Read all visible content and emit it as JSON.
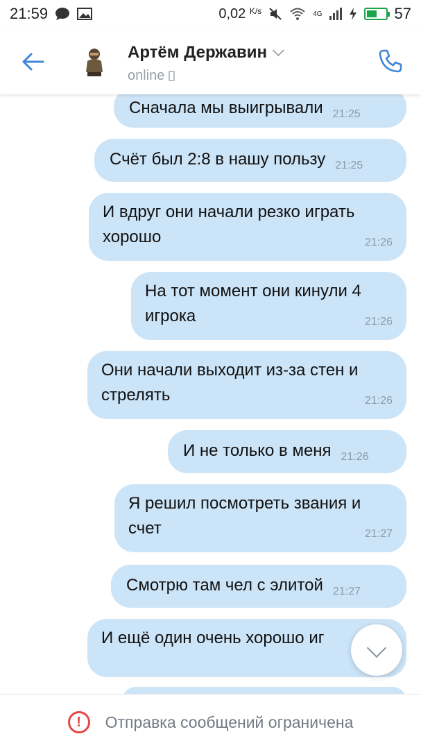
{
  "status_bar": {
    "time": "21:59",
    "speed": "0,02",
    "speed_unit": "K/s",
    "network": "4G",
    "battery": "57",
    "battery_level": 0.57
  },
  "header": {
    "contact_name": "Артём Державин",
    "presence": "online"
  },
  "messages": [
    {
      "text": "Сначала мы выигрывали",
      "time": "21:25"
    },
    {
      "text": "Счёт был 2:8 в нашу пользу",
      "time": "21:25"
    },
    {
      "text": "И вдруг они начали резко играть хорошо",
      "time": "21:26"
    },
    {
      "text": "На тот момент они кинули 4 игрока",
      "time": "21:26"
    },
    {
      "text": "Они начали выходит из-за стен и стрелять",
      "time": "21:26"
    },
    {
      "text": "И не только в меня",
      "time": "21:26"
    },
    {
      "text": "Я решил посмотреть звания и счет",
      "time": "21:27"
    },
    {
      "text": "Смотрю там чел с элитой",
      "time": "21:27"
    },
    {
      "text": "И ещё один очень хорошо иг",
      "time": ""
    }
  ],
  "bottom": {
    "restricted_text": "Отправка сообщений ограничена"
  },
  "colors": {
    "accent": "#3f86d6",
    "bubble": "#cce4f7",
    "warning": "#e64646"
  },
  "icons": [
    "chat-icon",
    "image-icon",
    "mute-icon",
    "wifi-icon",
    "signal-icon",
    "charging-icon",
    "back-arrow-icon",
    "phone-icon",
    "chevron-down-icon",
    "warning-icon"
  ]
}
